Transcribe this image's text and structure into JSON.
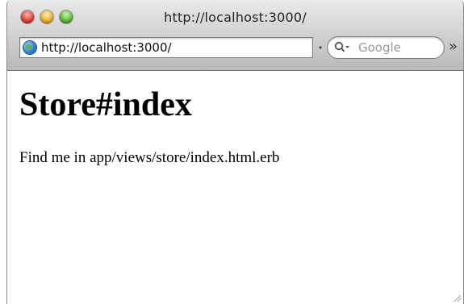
{
  "window": {
    "title": "http://localhost:3000/"
  },
  "toolbar": {
    "address": "http://localhost:3000/",
    "search_placeholder": "Google",
    "overflow_glyph": "»"
  },
  "page": {
    "heading": "Store#index",
    "paragraph": "Find me in app/views/store/index.html.erb"
  },
  "colors": {
    "close": "#e0443b",
    "minimize": "#f1b530",
    "zoom": "#5dbd3b"
  },
  "icons": [
    "close-icon",
    "minimize-icon",
    "zoom-icon",
    "globe-icon",
    "search-icon",
    "overflow-chevron-icon",
    "resize-grip-icon"
  ]
}
